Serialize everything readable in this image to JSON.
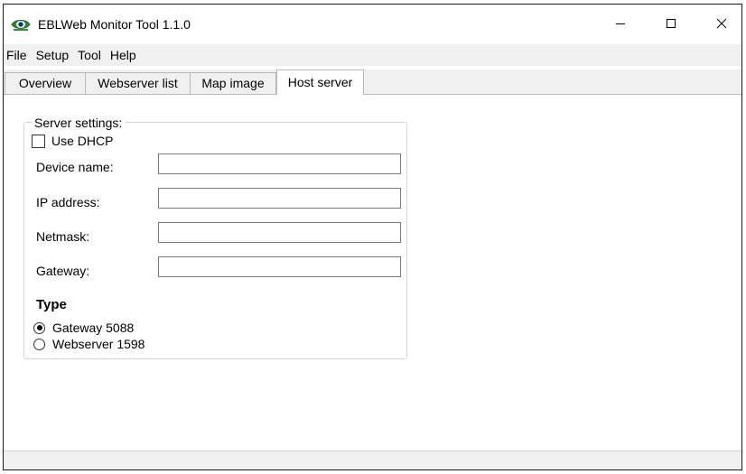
{
  "window": {
    "title": "EBLWeb Monitor Tool 1.1.0",
    "icon": "eye-app-icon",
    "controls": {
      "minimize": "minimize-icon",
      "maximize": "maximize-icon",
      "close": "close-icon"
    }
  },
  "menu": {
    "items": [
      "File",
      "Setup",
      "Tool",
      "Help"
    ]
  },
  "tabs": {
    "items": [
      "Overview",
      "Webserver list",
      "Map image",
      "Host server"
    ],
    "selected": "Host server"
  },
  "server_settings": {
    "legend": "Server settings:",
    "use_dhcp_label": "Use DHCP",
    "use_dhcp_checked": false,
    "fields": [
      {
        "label": "Device name:",
        "value": ""
      },
      {
        "label": "IP address:",
        "value": ""
      },
      {
        "label": "Netmask:",
        "value": ""
      },
      {
        "label": "Gateway:",
        "value": ""
      }
    ],
    "type_heading": "Type",
    "type_options": [
      {
        "label": "Gateway 5088",
        "selected": true
      },
      {
        "label": "Webserver 1598",
        "selected": false
      }
    ]
  },
  "colors": {
    "chrome": "#f0f0f0",
    "border": "#b8b8b8",
    "app_icon_green": "#2e8b3a"
  }
}
